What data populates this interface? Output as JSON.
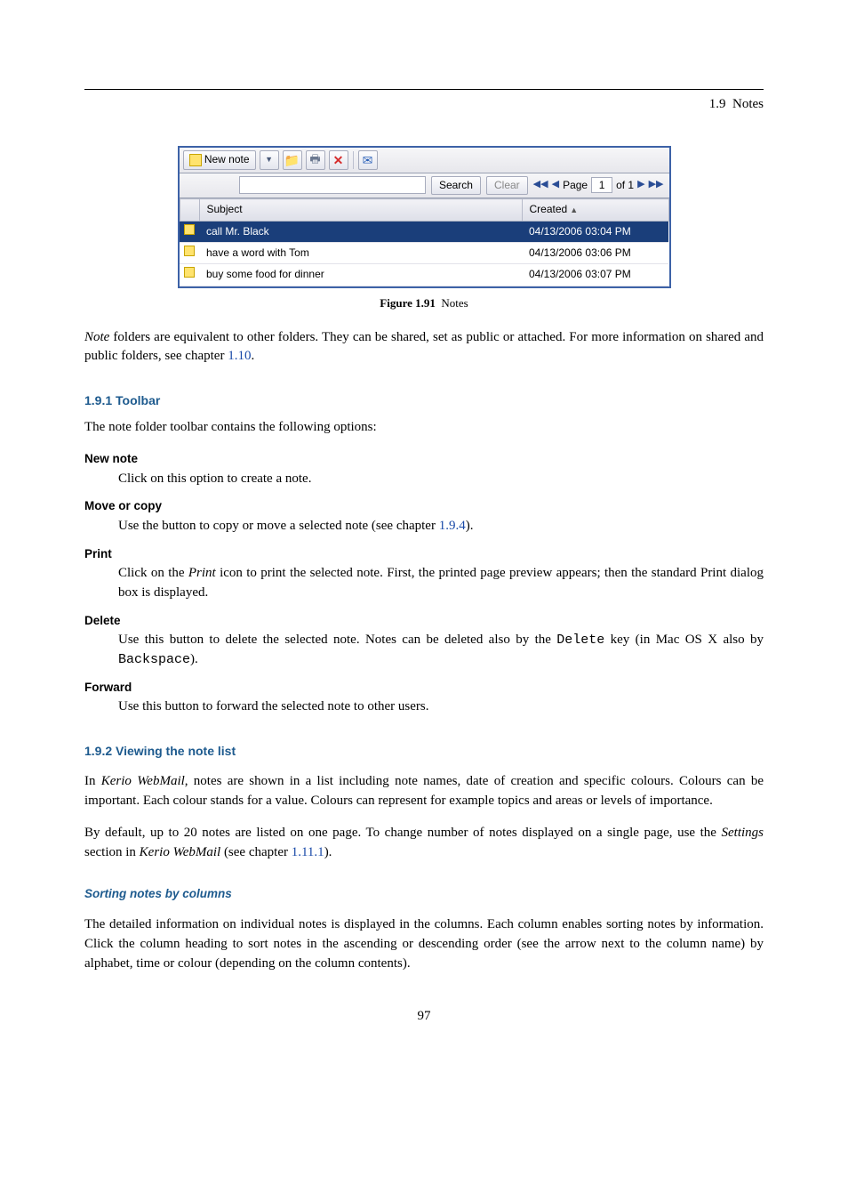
{
  "header": {
    "section": "1.9",
    "title": "Notes"
  },
  "figure": {
    "toolbar": {
      "new_note": "New note"
    },
    "search": {
      "search_btn": "Search",
      "clear_btn": "Clear",
      "page_label": "Page",
      "page_value": "1",
      "of_label": "of 1"
    },
    "columns": {
      "subject": "Subject",
      "created": "Created"
    },
    "rows": [
      {
        "subject": "call Mr. Black",
        "created": "04/13/2006 03:04 PM",
        "selected": true
      },
      {
        "subject": "have a word with Tom",
        "created": "04/13/2006 03:06 PM",
        "selected": false
      },
      {
        "subject": "buy some food for dinner",
        "created": "04/13/2006 03:07 PM",
        "selected": false
      }
    ],
    "caption_label": "Figure 1.91",
    "caption_text": "Notes"
  },
  "intro": {
    "p1a": "Note",
    "p1b": " folders are equivalent to other folders. They can be shared, set as public or attached. For more information on shared and public folders, see chapter ",
    "p1link": "1.10",
    "p1c": "."
  },
  "sec191": {
    "heading": "1.9.1  Toolbar",
    "lead": "The note folder toolbar contains the following options:",
    "items": {
      "new_note_t": "New note",
      "new_note_d": "Click on this option to create a note.",
      "move_t": "Move or copy",
      "move_d_a": "Use the button to copy or move a selected note (see chapter ",
      "move_link": "1.9.4",
      "move_d_b": ").",
      "print_t": "Print",
      "print_d_a": "Click on the ",
      "print_i": "Print",
      "print_d_b": " icon to print the selected note. First, the printed page preview appears; then the standard Print dialog box is displayed.",
      "delete_t": "Delete",
      "delete_d_a": "Use this button to delete the selected note. Notes can be deleted also by the ",
      "delete_code1": "Delete",
      "delete_d_b": " key (in Mac OS X also by ",
      "delete_code2": "Backspace",
      "delete_d_c": ").",
      "forward_t": "Forward",
      "forward_d": "Use this button to forward the selected note to other users."
    }
  },
  "sec192": {
    "heading": "1.9.2  Viewing the note list",
    "p1a": "In ",
    "p1i": "Kerio WebMail",
    "p1b": ", notes are shown in a list including note names, date of creation and specific colours. Colours can be important. Each colour stands for a value. Colours can represent for example topics and areas or levels of importance.",
    "p2a": "By default, up to 20 notes are listed on one page. To change number of notes displayed on a single page, use the ",
    "p2i1": "Settings",
    "p2b": " section in ",
    "p2i2": "Kerio WebMail",
    "p2c": " (see chapter ",
    "p2link": "1.11.1",
    "p2d": ")."
  },
  "sorting": {
    "heading": "Sorting notes by columns",
    "p": "The detailed information on individual notes is displayed in the columns. Each column enables sorting notes by information. Click the column heading to sort notes in the ascending or descending order (see the arrow next to the column name) by alphabet, time or colour (depending on the column contents)."
  },
  "page_number": "97"
}
